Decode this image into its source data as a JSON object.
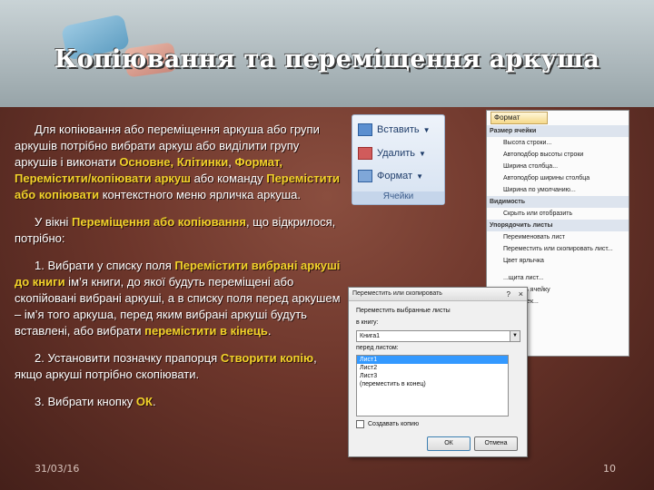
{
  "slide": {
    "title": "Копіювання та переміщення аркуша",
    "date": "31/03/16",
    "page_number": "10"
  },
  "text": {
    "p1_a": "Для копіювання або переміщення аркуша або групи аркушів потрібно вибрати аркуш або виділити групу аркушів і виконати ",
    "p1_hl1": "Основне, Клітинки",
    "p1_b": ", ",
    "p1_hl2": "Формат, Перемістити/копіювати аркуш",
    "p1_c": " або команду ",
    "p1_hl3": "Перемістити або копіювати",
    "p1_d": " контекстного меню ярличка аркуша.",
    "p2_a": "У вікні ",
    "p2_hl": "Переміщення або копіювання",
    "p2_b": ", що відкрилося, потрібно:",
    "p3_a": "1. Вибрати у списку поля ",
    "p3_hl1": "Перемістити вибрані аркуші до книги",
    "p3_b": " ім’я книги, до якої будуть переміщені або скопійовані вибрані аркуші, а в списку поля перед аркушем – ім’я того аркуша, перед яким вибрані аркуші будуть вставлені, або вибрати ",
    "p3_hl2": "перемістити в кінець",
    "p3_c": ".",
    "p4_a": "2. Установити позначку прапорця ",
    "p4_hl": "Створити копію",
    "p4_b": ", якщо аркуші потрібно скопіювати.",
    "p5_a": "3. Вибрати кнопку ",
    "p5_hl": "ОК",
    "p5_b": "."
  },
  "ribbon": {
    "insert": "Вставить",
    "delete": "Удалить",
    "format": "Формат",
    "group": "Ячейки"
  },
  "format_menu": {
    "button": "Формат",
    "sections": [
      {
        "title": "Размер ячейки",
        "items": [
          "Высота строки...",
          "Автоподбор высоты строки",
          "Ширина столбца...",
          "Автоподбор ширины столбца",
          "Ширина по умолчанию..."
        ]
      },
      {
        "title": "Видимость",
        "items": [
          "Скрыть или отобразить"
        ]
      },
      {
        "title": "Упорядочить листы",
        "items": [
          "Переименовать лист",
          "Переместить или скопировать лист...",
          "Цвет ярлычка"
        ]
      },
      {
        "title": "",
        "items": [
          "...щита лист...",
          "...ровать ячейку",
          "...ат ячеек..."
        ]
      }
    ]
  },
  "dialog": {
    "title": "Переместить или скопировать",
    "help": "?",
    "close": "×",
    "move_label": "Переместить выбранные листы",
    "book_label": "в книгу:",
    "book_value": "Книга1",
    "before_label": "перед листом:",
    "sheets": [
      "Лист1",
      "Лист2",
      "Лист3",
      "(переместить в конец)"
    ],
    "selected_index": 0,
    "copy_label": "Создавать копию",
    "ok": "ОК",
    "cancel": "Отмена"
  }
}
